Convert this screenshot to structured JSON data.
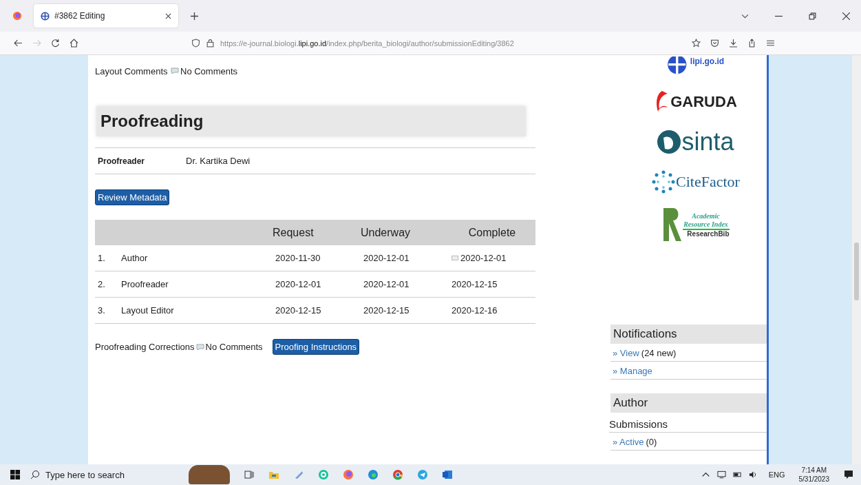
{
  "browser": {
    "tab_title": "#3862 Editing",
    "url_prefix": "https://e-journal.biologi.",
    "url_domain": "lipi.go.id",
    "url_path": "/index.php/berita_biologi/author/submissionEditing/3862"
  },
  "layout_comments": {
    "label": "Layout Comments",
    "value": "No Comments"
  },
  "section_title": "Proofreading",
  "proofreader": {
    "label": "Proofreader",
    "value": "Dr. Kartika Dewi"
  },
  "review_button": "Review Metadata",
  "table": {
    "columns": [
      "Request",
      "Underway",
      "Complete"
    ],
    "rows": [
      {
        "num": "1.",
        "role": "Author",
        "request": "2020-11-30",
        "underway": "2020-12-01",
        "complete": "2020-12-01",
        "has_note": true
      },
      {
        "num": "2.",
        "role": "Proofreader",
        "request": "2020-12-01",
        "underway": "2020-12-01",
        "complete": "2020-12-15",
        "has_note": false
      },
      {
        "num": "3.",
        "role": "Layout Editor",
        "request": "2020-12-15",
        "underway": "2020-12-15",
        "complete": "2020-12-16",
        "has_note": false
      }
    ]
  },
  "corrections": {
    "label": "Proofreading Corrections",
    "value": "No Comments",
    "button": "Proofing Instructions"
  },
  "sidebar": {
    "logos": [
      {
        "kind": "lipi",
        "text": "lipi.go.id"
      },
      {
        "kind": "garuda",
        "text": "GARUDA"
      },
      {
        "kind": "sinta",
        "text": "sinta"
      },
      {
        "kind": "citefactor",
        "text": "CiteFactor"
      },
      {
        "kind": "researchbib",
        "text": "Academic Resource Index",
        "sub": "ResearchBib"
      }
    ],
    "blocks": [
      {
        "title": "Notifications",
        "links": [
          {
            "label": "» View",
            "note": "(24 new)"
          },
          {
            "label": "» Manage"
          }
        ]
      },
      {
        "title": "Author",
        "subtitle": "Submissions",
        "links": [
          {
            "label": "» Active",
            "note": "(0)"
          }
        ]
      }
    ]
  },
  "taskbar": {
    "search_placeholder": "Type here to search",
    "language": "ENG",
    "time": "7:14 AM",
    "date": "5/31/2023"
  }
}
